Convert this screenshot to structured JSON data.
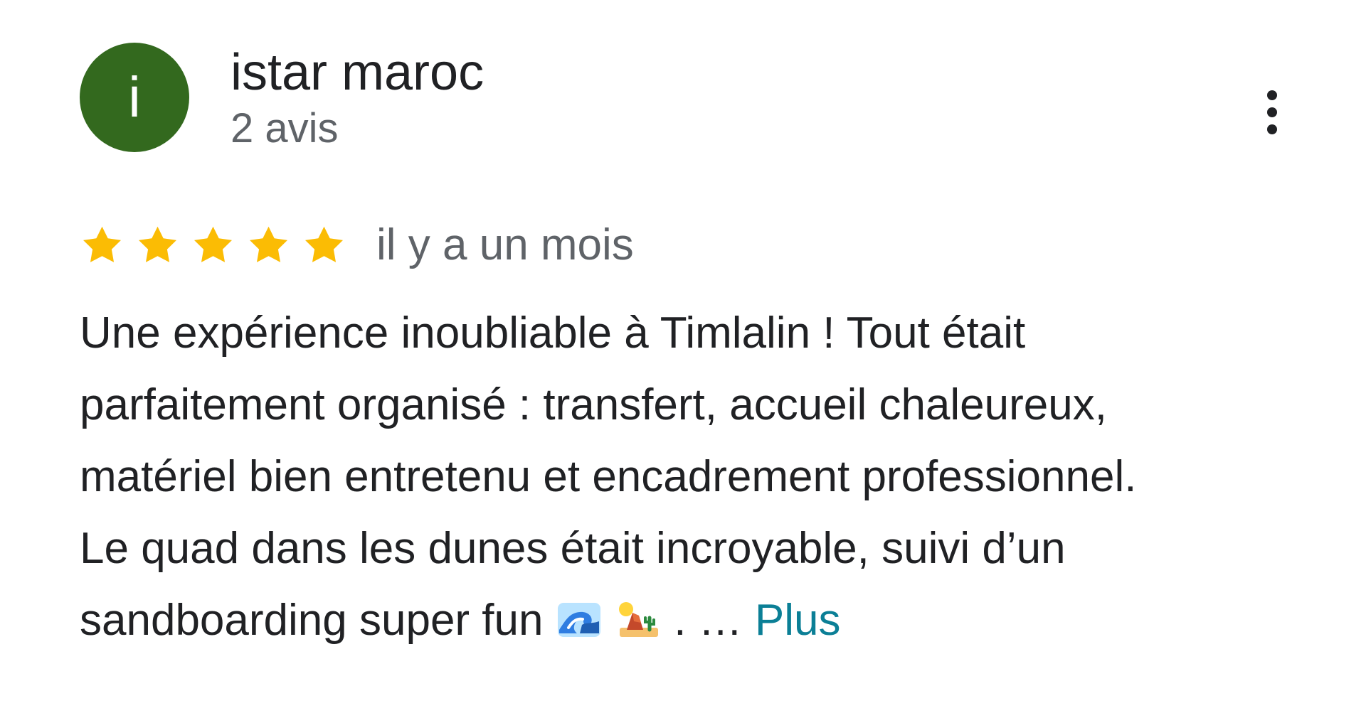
{
  "review": {
    "author_name": "istar maroc",
    "author_initial": "i",
    "review_count": "2 avis",
    "avatar_color": "#33691e",
    "rating": 5,
    "rating_max": 5,
    "star_color": "#fbbc04",
    "posted": "il y a un mois",
    "text_lines": [
      "Une expérience inoubliable à Timlalin ! Tout était",
      "parfaitement organisé : transfert, accueil chaleureux,",
      "matériel bien entretenu et encadrement professionnel.",
      "Le quad dans les dunes était incroyable, suivi d’un",
      "sandboarding super fun"
    ],
    "emojis": [
      "wave-emoji",
      "desert-emoji"
    ],
    "text_tail": ". …",
    "more_label": "Plus",
    "more_color": "#0b7f96",
    "menu_icon": "more-vert-icon"
  }
}
